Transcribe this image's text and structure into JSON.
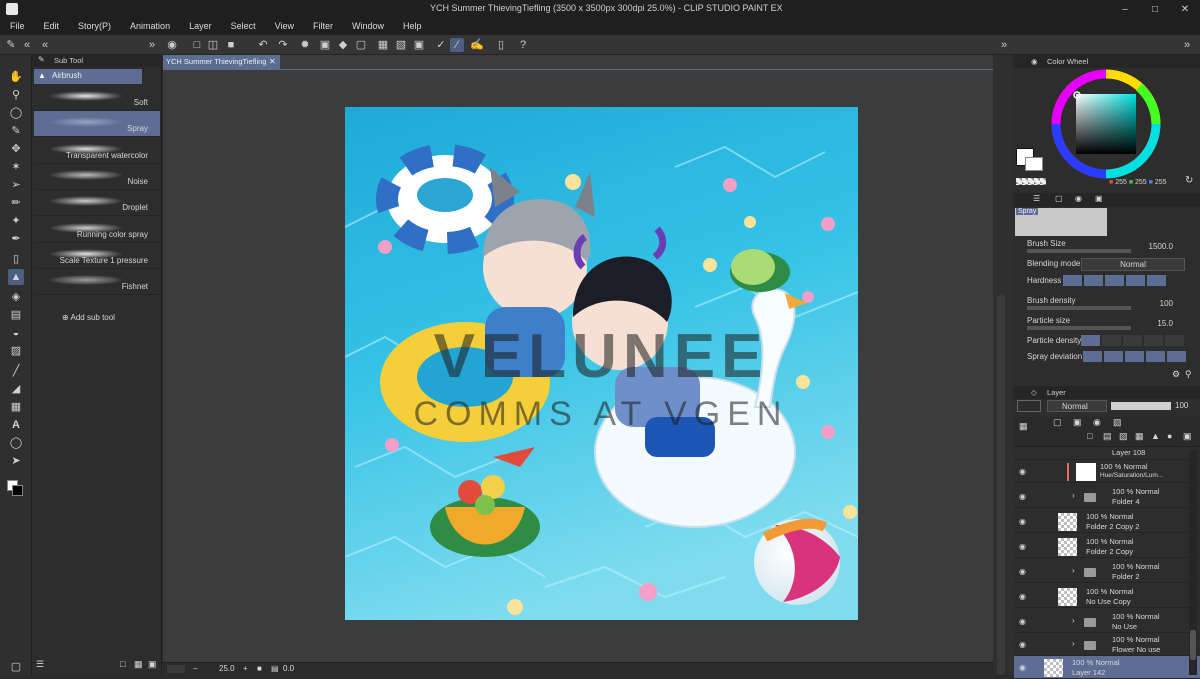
{
  "window": {
    "title": "YCH Summer ThievingTiefling (3500 x 3500px 300dpi 25.0%) - CLIP STUDIO PAINT EX",
    "controls": [
      "minimize-icon",
      "maximize-icon",
      "close-icon"
    ]
  },
  "menu": [
    "File",
    "Edit",
    "Story(P)",
    "Animation",
    "Layer",
    "Select",
    "View",
    "Filter",
    "Window",
    "Help"
  ],
  "subtool": {
    "panel_title": "Sub Tool",
    "group": "Airbrush",
    "items": [
      "Soft",
      "Spray",
      "Transparent watercolor",
      "Noise",
      "Droplet",
      "Running color spray",
      "Scale Texture 1 pressure",
      "Fishnet"
    ],
    "selected": "Spray",
    "add_label": "Add sub tool"
  },
  "document": {
    "tab_label": "YCH Summer ThievingTiefling",
    "watermark_main": "VELUNEE",
    "watermark_sub": "COMMS AT VGEN"
  },
  "status": {
    "zoom": "25.0",
    "angle": "0.0"
  },
  "color_wheel": {
    "panel_title": "Color Wheel",
    "r": "255",
    "g": "255",
    "b": "255",
    "main_color": "#ffffff"
  },
  "tool_property": {
    "brush_name": "Spray",
    "rows": [
      {
        "label": "Brush Size",
        "value": "1500.0"
      },
      {
        "label": "Blending mode",
        "value": "Normal"
      },
      {
        "label": "Hardness",
        "value": ""
      },
      {
        "label": "Brush density",
        "value": "100"
      },
      {
        "label": "Particle size",
        "value": "15.0"
      },
      {
        "label": "Particle density",
        "value": ""
      },
      {
        "label": "Spray deviation",
        "value": ""
      }
    ]
  },
  "layer_panel": {
    "panel_title": "Layer",
    "blend_mode": "Normal",
    "opacity": "100",
    "layers": [
      {
        "line1": "Layer 108",
        "line2": "",
        "type": "layer"
      },
      {
        "line1": "100 % Normal",
        "line2": "Hue/Saturation/Lum...",
        "type": "correction"
      },
      {
        "line1": "100 % Normal",
        "line2": "Folder 4",
        "type": "folder"
      },
      {
        "line1": "100 % Normal",
        "line2": "Folder 2 Copy 2",
        "type": "layer"
      },
      {
        "line1": "100 % Normal",
        "line2": "Folder 2 Copy",
        "type": "layer"
      },
      {
        "line1": "100 % Normal",
        "line2": "Folder 2",
        "type": "folder"
      },
      {
        "line1": "100 % Normal",
        "line2": "No Use Copy",
        "type": "layer"
      },
      {
        "line1": "100 % Normal",
        "line2": "No Use",
        "type": "folder"
      },
      {
        "line1": "100 % Normal",
        "line2": "Flower No use",
        "type": "folder"
      },
      {
        "line1": "100 % Normal",
        "line2": "Layer 142",
        "type": "layer"
      }
    ]
  }
}
